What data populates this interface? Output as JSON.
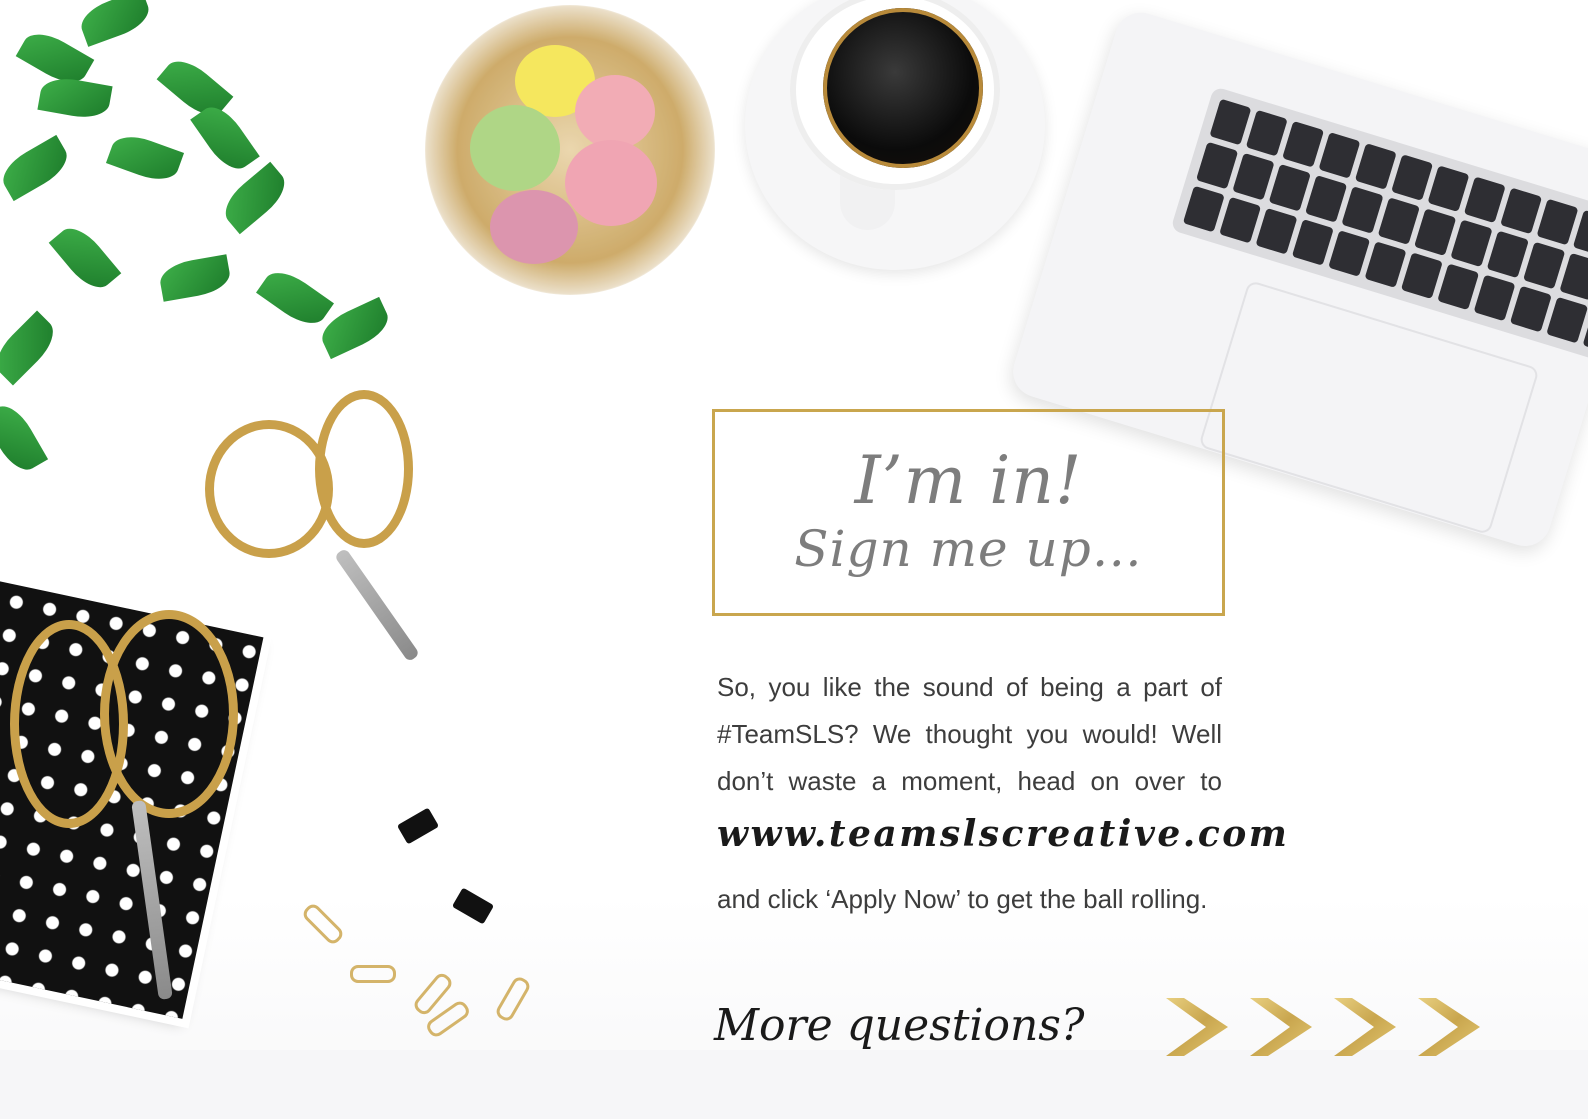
{
  "colors": {
    "gold": "#c9a64e",
    "heading_gray": "#7d7d7d",
    "body_text": "#3d3d3d",
    "dark_text": "#1a1a1a"
  },
  "signup": {
    "title": "I’m in!",
    "subtitle": "Sign me up…"
  },
  "body": {
    "paragraph": "So, you like the sound of being a part of #TeamSLS? We thought you would! Well don’t waste a moment, head on over to",
    "url": "www.teamslscreative.com",
    "closing": "and click ‘Apply Now’ to get the ball rolling."
  },
  "footer": {
    "more_questions": "More questions?",
    "arrow_icons": [
      "chevron-right-icon",
      "chevron-right-icon",
      "chevron-right-icon",
      "chevron-right-icon"
    ]
  }
}
